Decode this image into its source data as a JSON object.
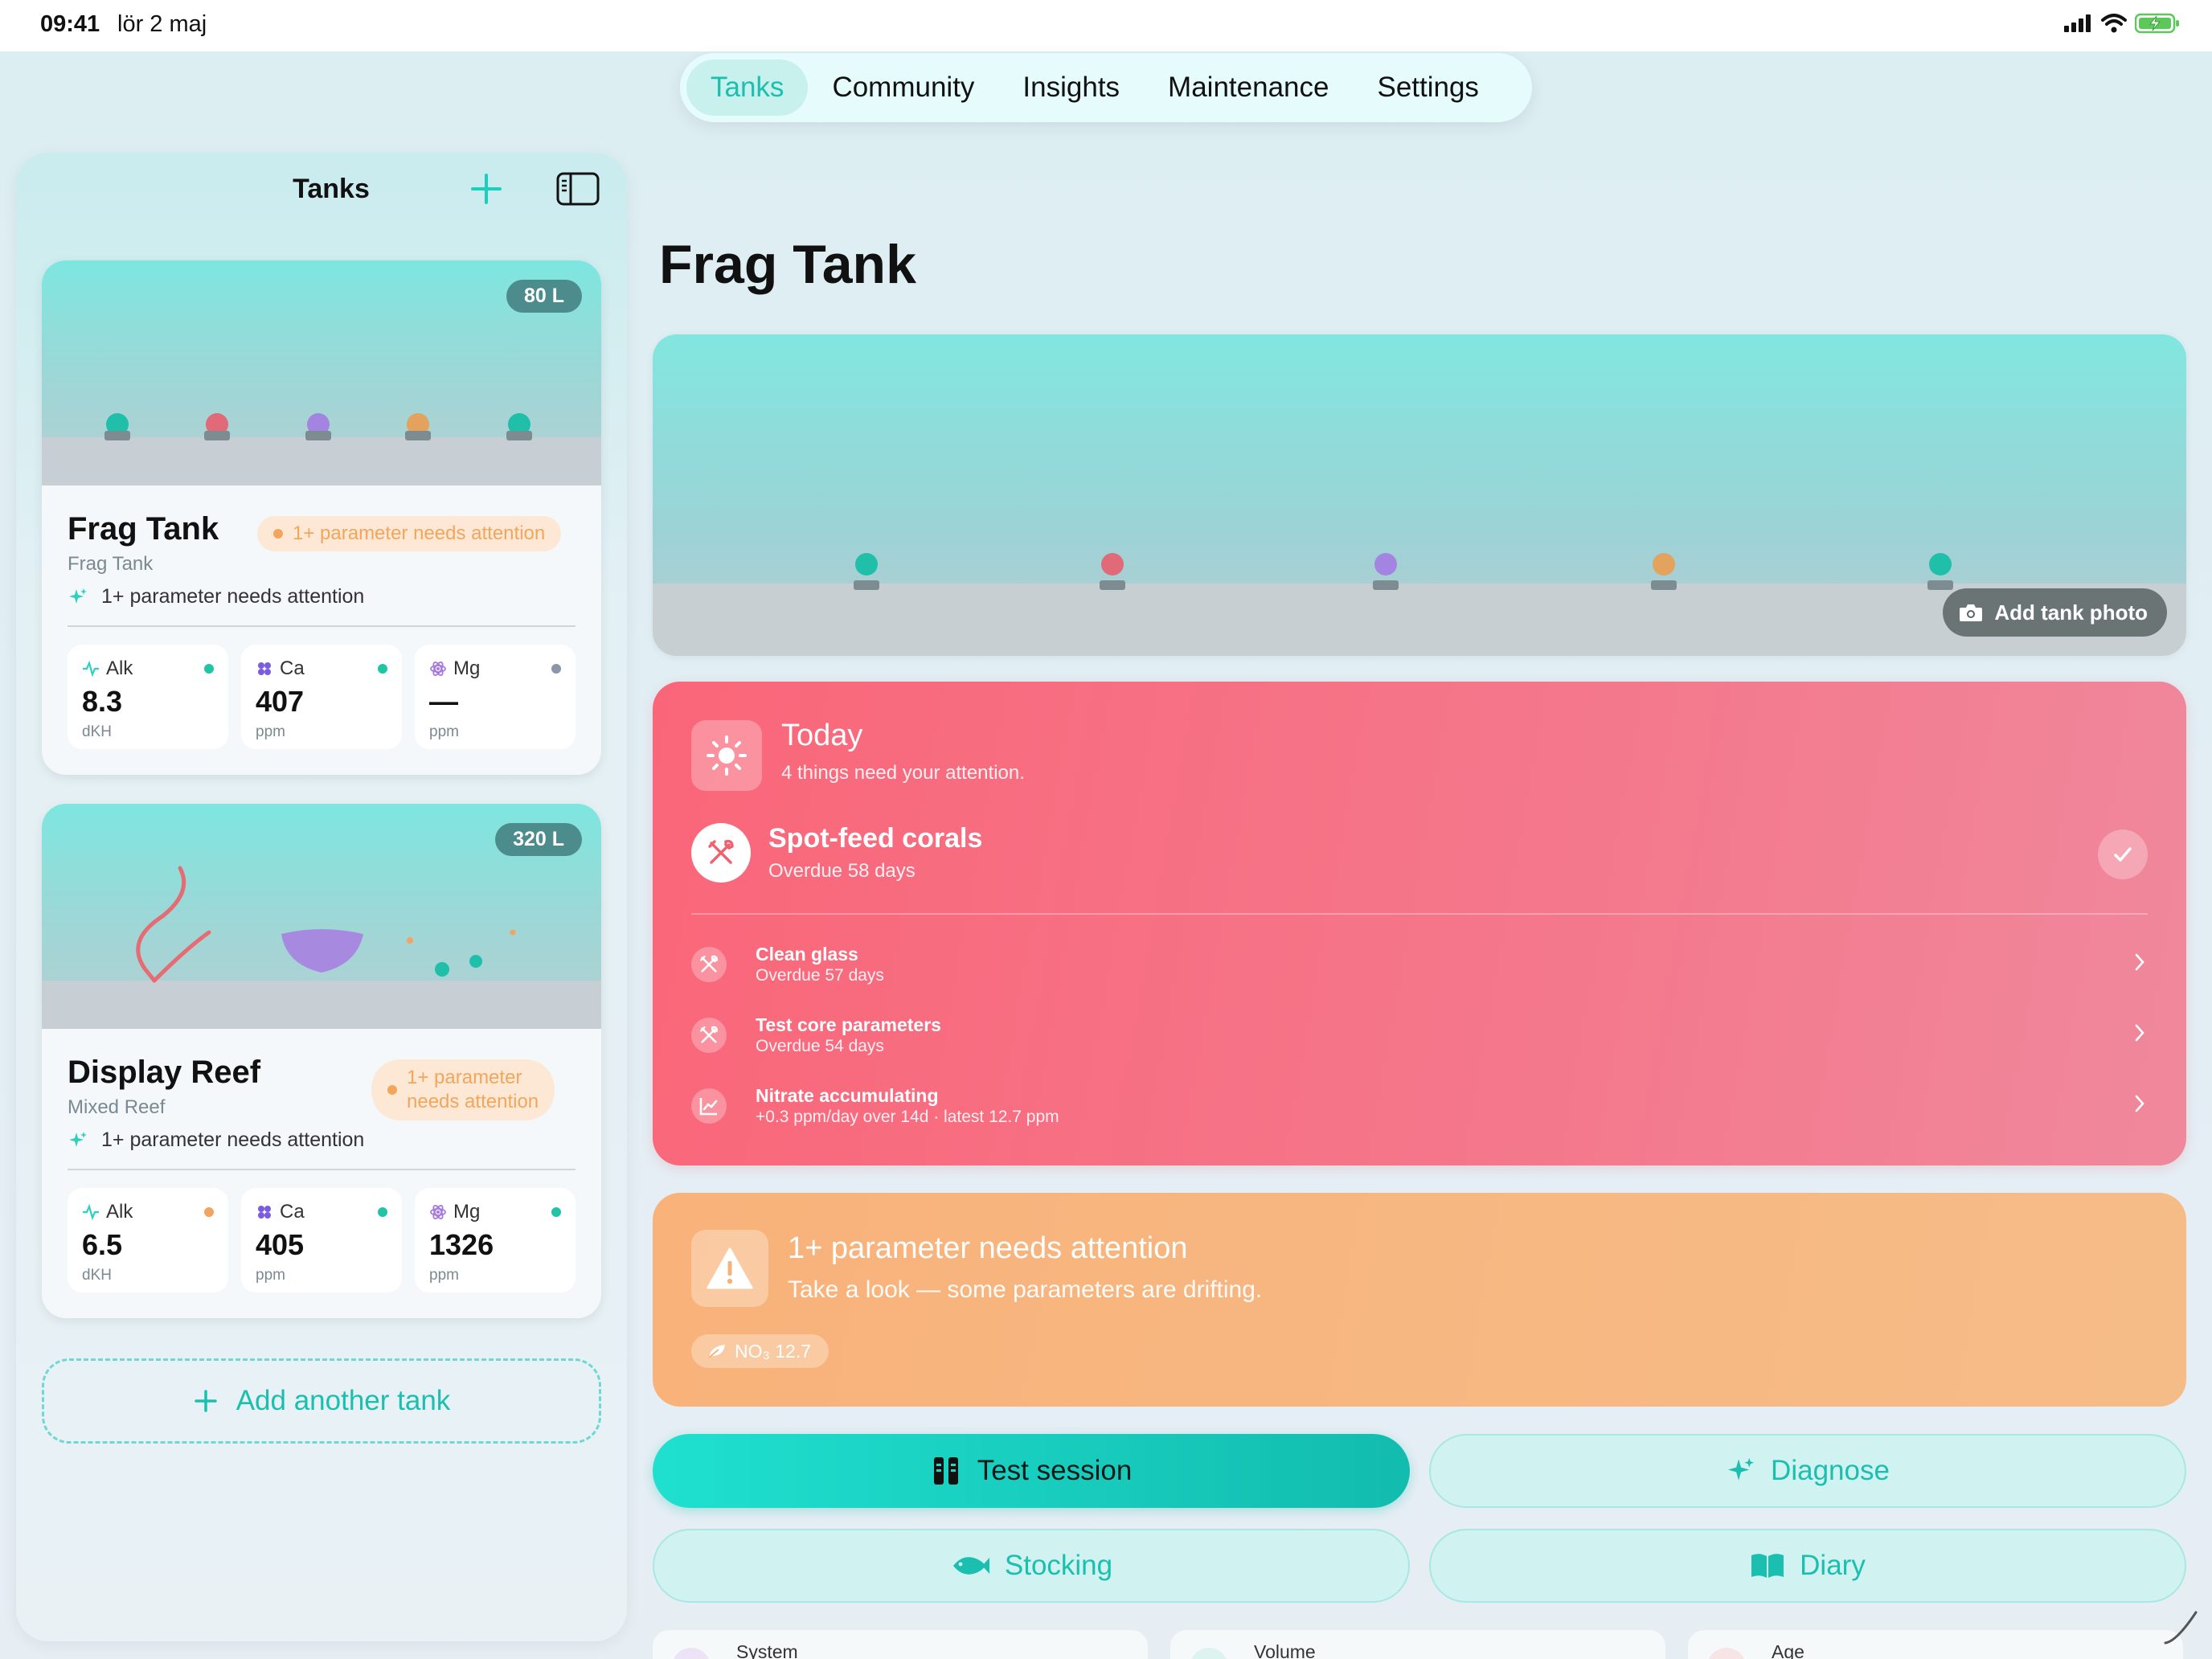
{
  "status_bar": {
    "time": "09:41",
    "date": "lör 2 maj"
  },
  "top_nav": {
    "tabs": [
      "Tanks",
      "Community",
      "Insights",
      "Maintenance",
      "Settings"
    ],
    "active": "Tanks"
  },
  "sidebar": {
    "title": "Tanks",
    "tanks": [
      {
        "name": "Frag Tank",
        "subtitle": "Frag Tank",
        "volume": "80 L",
        "pill": "1+ parameter needs attention",
        "note": "1+ parameter needs attention",
        "params": [
          {
            "label": "Alk",
            "value": "8.3",
            "unit": "dKH",
            "status_color": "#22c4a8"
          },
          {
            "label": "Ca",
            "value": "407",
            "unit": "ppm",
            "status_color": "#22c4a8"
          },
          {
            "label": "Mg",
            "value": "—",
            "unit": "ppm",
            "status_color": "#8a97a6"
          }
        ]
      },
      {
        "name": "Display Reef",
        "subtitle": "Mixed Reef",
        "volume": "320 L",
        "pill_line1": "1+ parameter",
        "pill_line2": "needs attention",
        "note": "1+ parameter needs attention",
        "params": [
          {
            "label": "Alk",
            "value": "6.5",
            "unit": "dKH",
            "status_color": "#f4a35e"
          },
          {
            "label": "Ca",
            "value": "405",
            "unit": "ppm",
            "status_color": "#22c4a8"
          },
          {
            "label": "Mg",
            "value": "1326",
            "unit": "ppm",
            "status_color": "#22c4a8"
          }
        ]
      }
    ],
    "add_label": "Add another tank"
  },
  "main": {
    "title": "Frag Tank",
    "add_photo_label": "Add tank photo",
    "today": {
      "title": "Today",
      "subtitle": "4 things need your attention.",
      "main_task": {
        "title": "Spot-feed corals",
        "subtitle": "Overdue 58 days"
      },
      "tasks": [
        {
          "title": "Clean glass",
          "subtitle": "Overdue 57 days"
        },
        {
          "title": "Test core parameters",
          "subtitle": "Overdue 54 days"
        },
        {
          "title": "Nitrate accumulating",
          "subtitle": "+0.3 ppm/day over 14d · latest 12.7 ppm"
        }
      ]
    },
    "alert": {
      "title": "1+ parameter needs attention",
      "subtitle": "Take a look — some parameters are drifting.",
      "chip": "NO₃ 12.7"
    },
    "actions": {
      "test_session": "Test session",
      "diagnose": "Diagnose",
      "stocking": "Stocking",
      "diary": "Diary"
    },
    "stats": [
      "System",
      "Volume",
      "Age"
    ]
  },
  "colors": {
    "accent": "#1bbfb0",
    "today_bg": "#fa6679",
    "alert_bg": "#f8b27a",
    "warning": "#f2a65c"
  }
}
